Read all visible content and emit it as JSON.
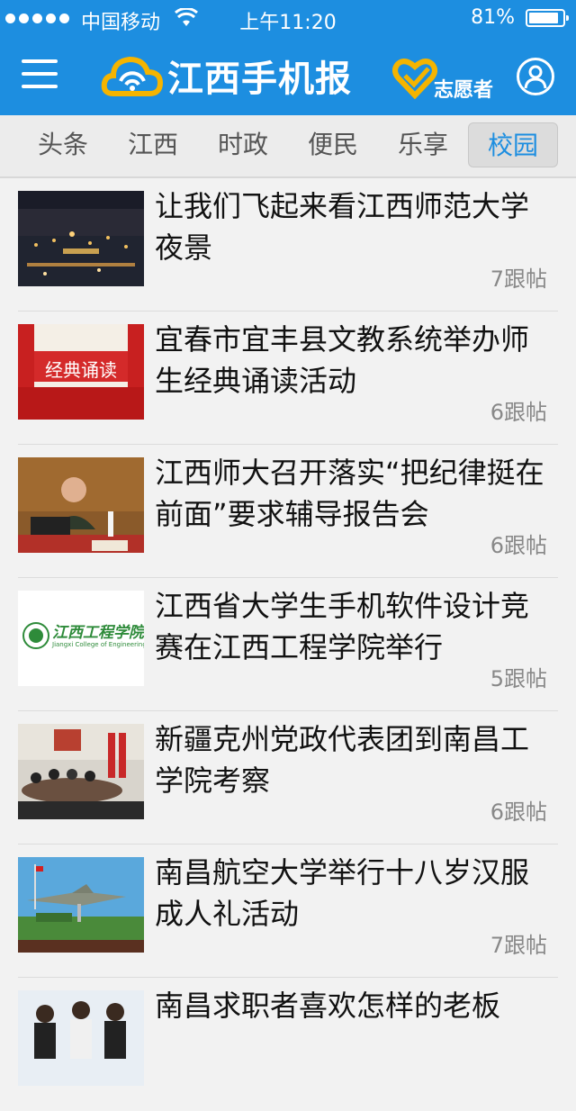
{
  "status": {
    "carrier": "中国移动",
    "time": "上午11:20",
    "battery": "81%"
  },
  "nav": {
    "logo_text": "江西手机报",
    "volunteer_label": "志愿者"
  },
  "tabs": [
    {
      "label": "头条"
    },
    {
      "label": "江西"
    },
    {
      "label": "时政"
    },
    {
      "label": "便民"
    },
    {
      "label": "乐享"
    },
    {
      "label": "校园"
    }
  ],
  "active_tab": "校园",
  "articles": [
    {
      "title": "让我们飞起来看江西师范大学夜景",
      "replies": "7跟帖"
    },
    {
      "title": "宜春市宜丰县文教系统举办师生经典诵读活动",
      "replies": "6跟帖",
      "thumb_text": "经典诵读"
    },
    {
      "title": "江西师大召开落实“把纪律挺在前面”要求辅导报告会",
      "replies": "6跟帖"
    },
    {
      "title": "江西省大学生手机软件设计竞赛在江西工程学院举行",
      "replies": "5跟帖",
      "thumb_text": "江西工程学院",
      "thumb_text_en": "Jiangxi College of Engineering"
    },
    {
      "title": "新疆克州党政代表团到南昌工学院考察",
      "replies": "6跟帖"
    },
    {
      "title": "南昌航空大学举行十八岁汉服成人礼活动",
      "replies": "7跟帖"
    },
    {
      "title": "南昌求职者喜欢怎样的老板",
      "replies": ""
    }
  ],
  "colors": {
    "brand_blue": "#1d8ee0",
    "active_tab_text": "#1d8ee0",
    "logo_yellow": "#f5b400"
  }
}
